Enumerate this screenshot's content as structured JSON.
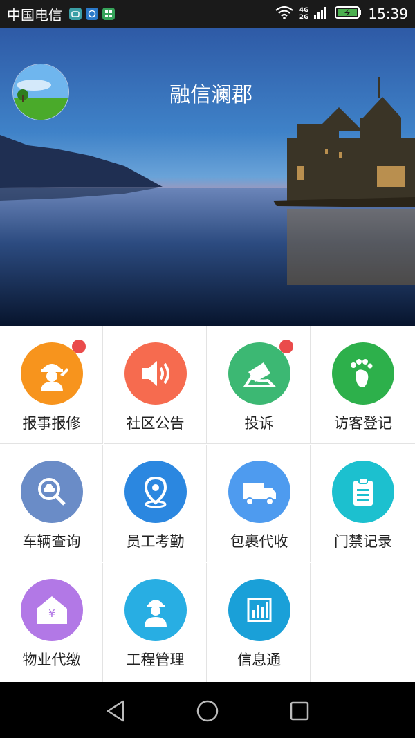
{
  "status_bar": {
    "carrier": "中国电信",
    "network_top": "4G",
    "network_bottom": "2G",
    "time": "15:39"
  },
  "header": {
    "title": "融信澜郡"
  },
  "menu": [
    {
      "label": "报事报修",
      "icon": "repair-worker-icon",
      "color": "#f7941d",
      "badge": true
    },
    {
      "label": "社区公告",
      "icon": "speaker-icon",
      "color": "#f66b4f",
      "badge": false
    },
    {
      "label": "投诉",
      "icon": "complaint-icon",
      "color": "#3cb873",
      "badge": true
    },
    {
      "label": "访客登记",
      "icon": "footprint-icon",
      "color": "#2db04b",
      "badge": false
    },
    {
      "label": "车辆查询",
      "icon": "vehicle-search-icon",
      "color": "#6a8cc7",
      "badge": false
    },
    {
      "label": "员工考勤",
      "icon": "location-pin-icon",
      "color": "#2b87e0",
      "badge": false
    },
    {
      "label": "包裹代收",
      "icon": "delivery-truck-icon",
      "color": "#4e9bef",
      "badge": false
    },
    {
      "label": "门禁记录",
      "icon": "clipboard-icon",
      "color": "#1cc0cf",
      "badge": false
    },
    {
      "label": "物业代缴",
      "icon": "house-payment-icon",
      "color": "#b278e6",
      "badge": false
    },
    {
      "label": "工程管理",
      "icon": "engineer-icon",
      "color": "#28aee3",
      "badge": false
    },
    {
      "label": "信息通",
      "icon": "bar-chart-icon",
      "color": "#1aa0d8",
      "badge": false
    }
  ],
  "colors": {
    "badge": "#ea4b4b",
    "status_bar_bg": "#1a1a1a",
    "nav_bar_bg": "#000000"
  }
}
